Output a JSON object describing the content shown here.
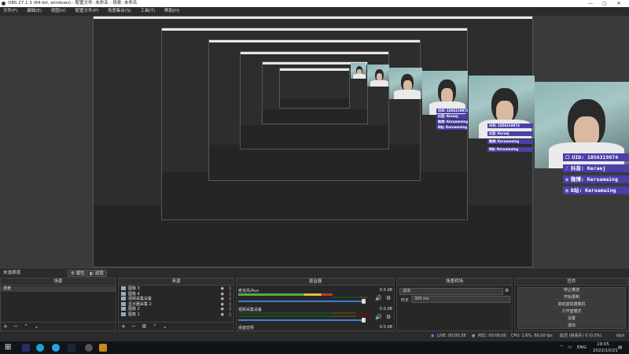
{
  "window": {
    "title": "OBS 27.1.3 (64-bit, windows) - 配置文件: 未命名 - 场景: 未命名",
    "minimize": "—",
    "maximize": "▢",
    "close": "✕"
  },
  "menu": [
    "文件(F)",
    "编辑(E)",
    "视图(V)",
    "配置文件(P)",
    "场景集合(S)",
    "工具(T)",
    "帮助(H)"
  ],
  "overlay": {
    "rows": [
      {
        "icon": "ᗝ",
        "text": "UID: 1856319874"
      },
      {
        "icon": "♪",
        "text": "抖音: Keraej"
      },
      {
        "icon": "◉",
        "text": "微博: Keruamaing"
      },
      {
        "icon": "▣",
        "text": "B站: Keruamaing"
      }
    ]
  },
  "docks_strip": {
    "label": "未选择源",
    "properties": "属性",
    "filters": "滤镜"
  },
  "scenes": {
    "header": "场景",
    "items": [
      "场景"
    ]
  },
  "sources": {
    "header": "来源",
    "items": [
      "图像 3",
      "图像 4",
      "视频采集设备",
      "显示器采集 2",
      "图像 2",
      "图像 1"
    ]
  },
  "mixer": {
    "header": "混音器",
    "channels": [
      {
        "name": "麦克风/Aux",
        "db": "0.0 dB"
      },
      {
        "name": "视频采集设备",
        "db": "0.0 dB"
      },
      {
        "name": "桌面音频",
        "db": "0.0 dB"
      }
    ]
  },
  "transitions": {
    "header": "场景转场",
    "type": "淡出",
    "duration_label": "时长",
    "duration": "300 ms"
  },
  "controls": {
    "header": "控件",
    "buttons": [
      "停止推流",
      "开始录制",
      "启动虚拟摄像机",
      "工作室模式",
      "设置",
      "退出"
    ]
  },
  "status": {
    "live": "LIVE: 00:00:38",
    "rec": "REC: 00:00:00",
    "cpu": "CPU: 1.6%, 60.00 fps",
    "lag": "延迟 (帧丢失) 0 (0.0%)",
    "bitrate": "kb/s"
  },
  "taskbar": {
    "time": "19:05",
    "date": "2022/10/21",
    "lang": "ENG",
    "apps": [
      "windows-logo",
      "media-app",
      "edge-browser",
      "telegram",
      "steam",
      "obs",
      "obs-window"
    ]
  }
}
